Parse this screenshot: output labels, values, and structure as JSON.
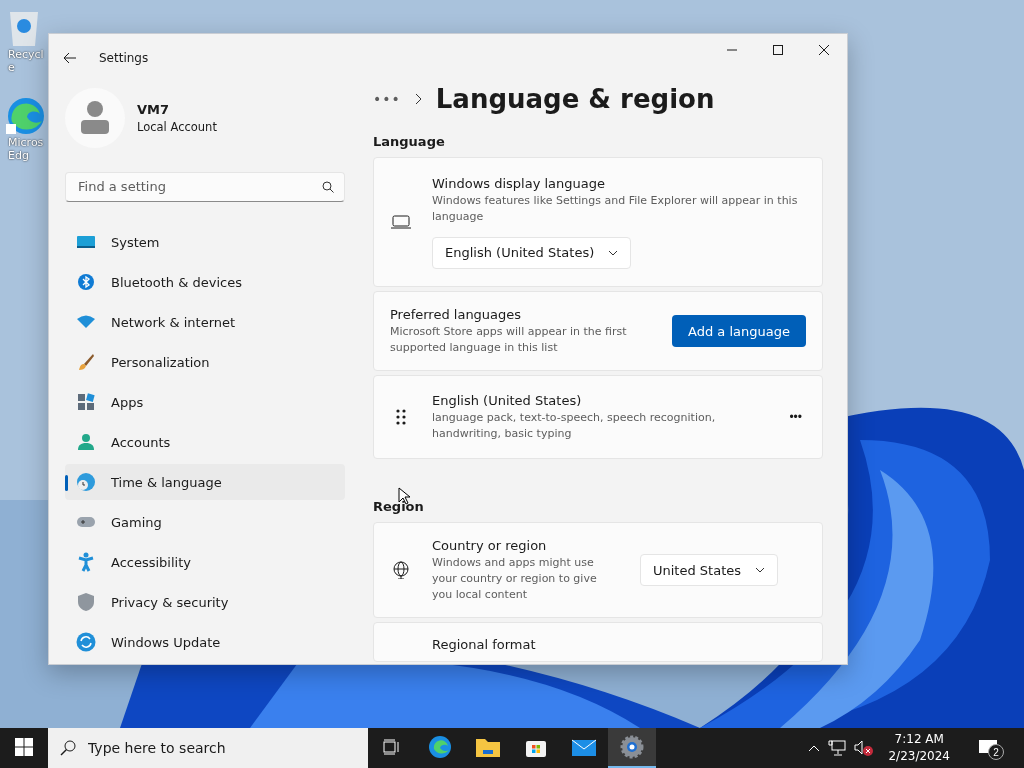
{
  "desktop_icons": [
    {
      "label": "Recycle"
    },
    {
      "label": "Micros Edg"
    }
  ],
  "window": {
    "title": "Settings"
  },
  "account": {
    "name": "VM7",
    "type": "Local Account"
  },
  "search": {
    "placeholder": "Find a setting"
  },
  "sidebar": {
    "items": [
      {
        "label": "System",
        "selected": false
      },
      {
        "label": "Bluetooth & devices",
        "selected": false
      },
      {
        "label": "Network & internet",
        "selected": false
      },
      {
        "label": "Personalization",
        "selected": false
      },
      {
        "label": "Apps",
        "selected": false
      },
      {
        "label": "Accounts",
        "selected": false
      },
      {
        "label": "Time & language",
        "selected": true
      },
      {
        "label": "Gaming",
        "selected": false
      },
      {
        "label": "Accessibility",
        "selected": false
      },
      {
        "label": "Privacy & security",
        "selected": false
      },
      {
        "label": "Windows Update",
        "selected": false
      }
    ]
  },
  "breadcrumb": {
    "overflow": "•••",
    "title": "Language & region"
  },
  "sections": [
    {
      "heading": "Language",
      "cards": [
        {
          "kind": "dropdown",
          "title": "Windows display language",
          "description": "Windows features like Settings and File Explorer will appear in this language",
          "value": "English (United States)"
        },
        {
          "kind": "button",
          "title": "Preferred languages",
          "description": "Microsoft Store apps will appear in the first supported language in this list",
          "button": "Add a language"
        },
        {
          "kind": "language",
          "title": "English (United States)",
          "description": "language pack, text-to-speech, speech recognition, handwriting, basic typing",
          "more": "•••"
        }
      ]
    },
    {
      "heading": "Region",
      "cards": [
        {
          "kind": "inline-dropdown",
          "title": "Country or region",
          "description": "Windows and apps might use your country or region to give you local content",
          "value": "United States"
        },
        {
          "kind": "partial",
          "title": "Regional format"
        }
      ]
    }
  ],
  "taskbar": {
    "search_placeholder": "Type here to search",
    "apps": [
      {
        "selected": false
      },
      {
        "selected": false
      },
      {
        "selected": false
      },
      {
        "selected": false
      },
      {
        "selected": false
      },
      {
        "selected": true
      }
    ],
    "time": "7:12 AM",
    "date": "2/23/2024",
    "notifications": "2"
  }
}
